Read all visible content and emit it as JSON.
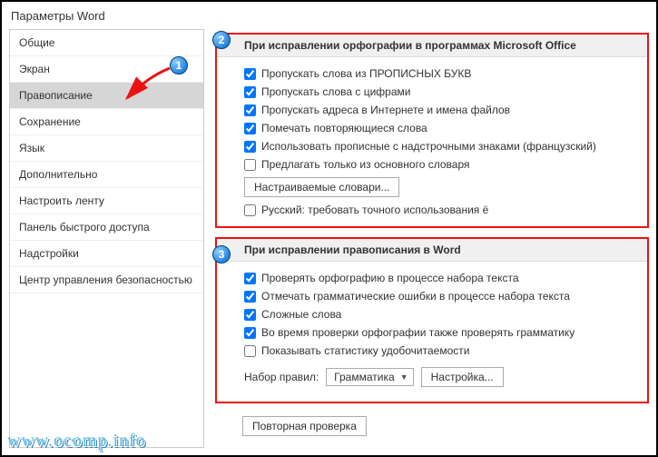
{
  "window": {
    "title": "Параметры Word"
  },
  "sidebar": {
    "items": [
      {
        "label": "Общие"
      },
      {
        "label": "Экран"
      },
      {
        "label": "Правописание"
      },
      {
        "label": "Сохранение"
      },
      {
        "label": "Язык"
      },
      {
        "label": "Дополнительно"
      },
      {
        "label": "Настроить ленту"
      },
      {
        "label": "Панель быстрого доступа"
      },
      {
        "label": "Надстройки"
      },
      {
        "label": "Центр управления безопасностью"
      }
    ],
    "selected_index": 2
  },
  "callouts": {
    "c1": "1",
    "c2": "2",
    "c3": "3"
  },
  "group1": {
    "title": "При исправлении орфографии в программах Microsoft Office",
    "checks": [
      {
        "label": "Пропускать слова из ПРОПИСНЫХ БУКВ",
        "checked": true
      },
      {
        "label": "Пропускать слова с цифрами",
        "checked": true
      },
      {
        "label": "Пропускать адреса в Интернете и имена файлов",
        "checked": true
      },
      {
        "label": "Помечать повторяющиеся слова",
        "checked": true
      },
      {
        "label": "Использовать прописные с надстрочными знаками (французский)",
        "checked": true
      },
      {
        "label": "Предлагать только из основного словаря",
        "checked": false
      }
    ],
    "dict_button": "Настраиваемые словари...",
    "last_check": {
      "label": "Русский: требовать точного использования ё",
      "checked": false
    }
  },
  "group2": {
    "title": "При исправлении правописания в Word",
    "checks": [
      {
        "label": "Проверять орфографию в процессе набора текста",
        "checked": true
      },
      {
        "label": "Отмечать грамматические ошибки в процессе набора текста",
        "checked": true
      },
      {
        "label": "Сложные слова",
        "checked": true
      },
      {
        "label": "Во время проверки орфографии также проверять грамматику",
        "checked": true
      },
      {
        "label": "Показывать статистику удобочитаемости",
        "checked": false
      }
    ],
    "ruleset_label": "Набор правил:",
    "ruleset_value": "Грамматика",
    "settings_button": "Настройка..."
  },
  "recheck_button": "Повторная проверка",
  "watermark": "www.ocomp.info"
}
